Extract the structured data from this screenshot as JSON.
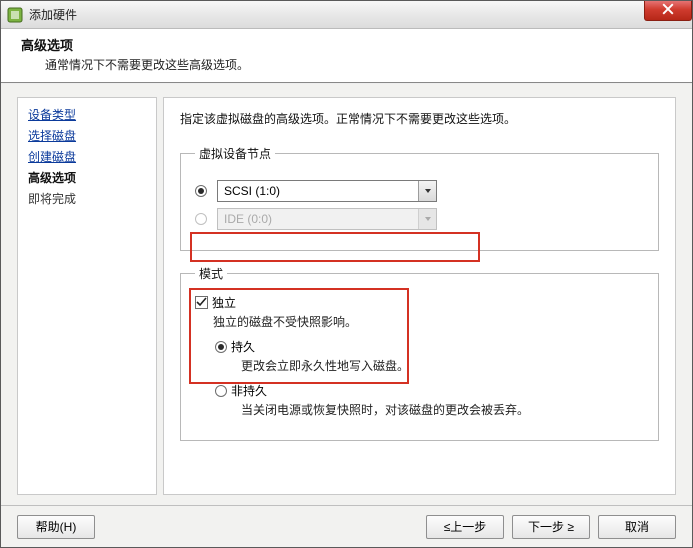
{
  "window": {
    "title": "添加硬件"
  },
  "header": {
    "title": "高级选项",
    "subtitle": "通常情况下不需要更改这些高级选项。"
  },
  "sidebar": {
    "items": [
      {
        "label": "设备类型"
      },
      {
        "label": "选择磁盘"
      },
      {
        "label": "创建磁盘"
      },
      {
        "label": "高级选项"
      },
      {
        "label": "即将完成"
      }
    ]
  },
  "main": {
    "instruction": "指定该虚拟磁盘的高级选项。正常情况下不需要更改这些选项。",
    "node_group": {
      "legend": "虚拟设备节点",
      "scsi_value": "SCSI (1:0)",
      "ide_value": "IDE (0:0)"
    },
    "mode_group": {
      "legend": "模式",
      "independent_label": "独立",
      "independent_desc": "独立的磁盘不受快照影响。",
      "persistent_label": "持久",
      "persistent_desc": "更改会立即永久性地写入磁盘。",
      "nonpersistent_label": "非持久",
      "nonpersistent_desc": "当关闭电源或恢复快照时，对该磁盘的更改会被丢弃。"
    }
  },
  "footer": {
    "help": "帮助(H)",
    "back": "≤上一步",
    "next": "下一步 ≥",
    "cancel": "取消"
  }
}
